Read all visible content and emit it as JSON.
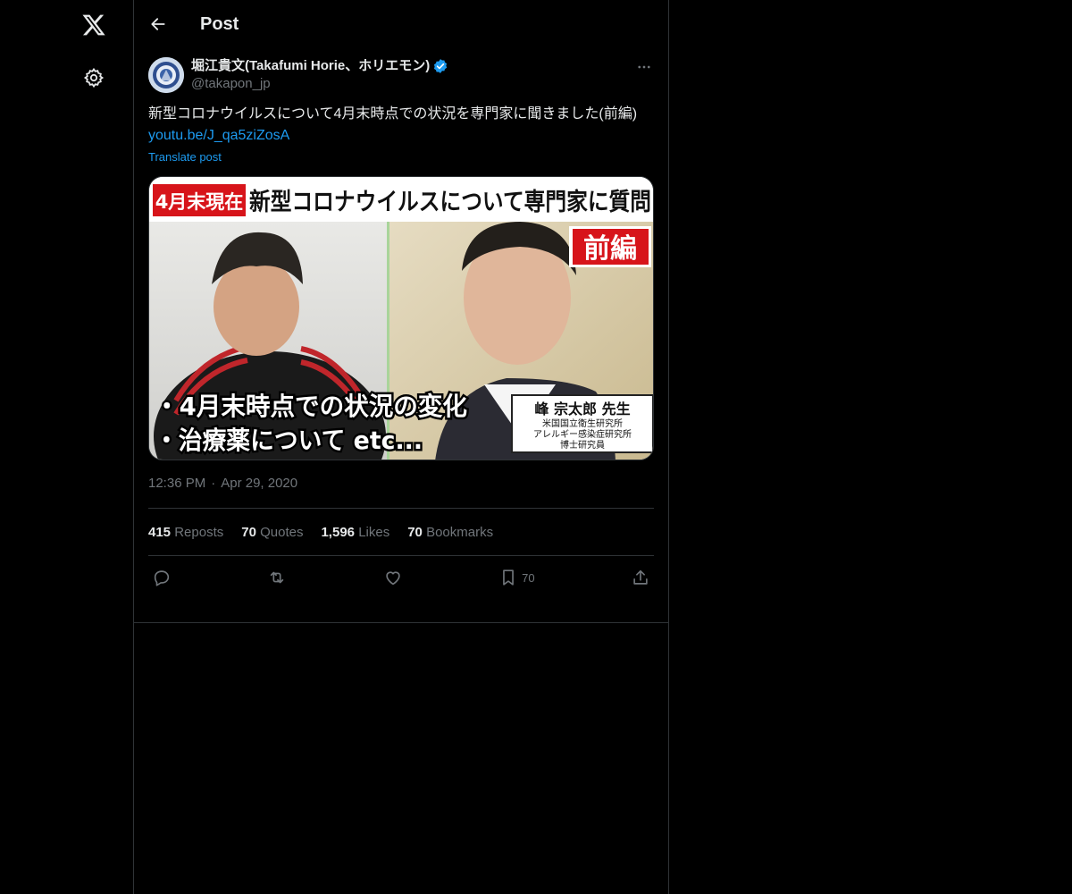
{
  "header": {
    "title": "Post"
  },
  "author": {
    "name": "堀江貴文(Takafumi Horie、ホリエモン)",
    "handle": "@takapon_jp"
  },
  "post": {
    "text": "新型コロナウイルスについて4月末時点での状況を専門家に聞きました(前編)",
    "link": "youtu.be/J_qa5ziZosA",
    "translate_label": "Translate post"
  },
  "media": {
    "banner_red": "4月末現在",
    "banner_title": "新型コロナウイルスについて専門家に質問",
    "part_label": "前編",
    "bullet1": "・4月末時点での状況の変化",
    "bullet2": "・治療薬について etc...",
    "expert_name": "峰 宗太郎 先生",
    "expert_aff1": "米国国立衛生研究所",
    "expert_aff2": "アレルギー感染症研究所",
    "expert_aff3": "博士研究員"
  },
  "meta": {
    "time": "12:36 PM",
    "separator": "·",
    "date": "Apr 29, 2020"
  },
  "stats": {
    "reposts_count": "415",
    "reposts_label": "Reposts",
    "quotes_count": "70",
    "quotes_label": "Quotes",
    "likes_count": "1,596",
    "likes_label": "Likes",
    "bookmarks_count": "70",
    "bookmarks_label": "Bookmarks"
  },
  "actions": {
    "bookmark_count": "70"
  },
  "colors": {
    "accent": "#1d9bf0",
    "background": "#000000",
    "border": "#2f3336",
    "muted": "#71767b"
  }
}
